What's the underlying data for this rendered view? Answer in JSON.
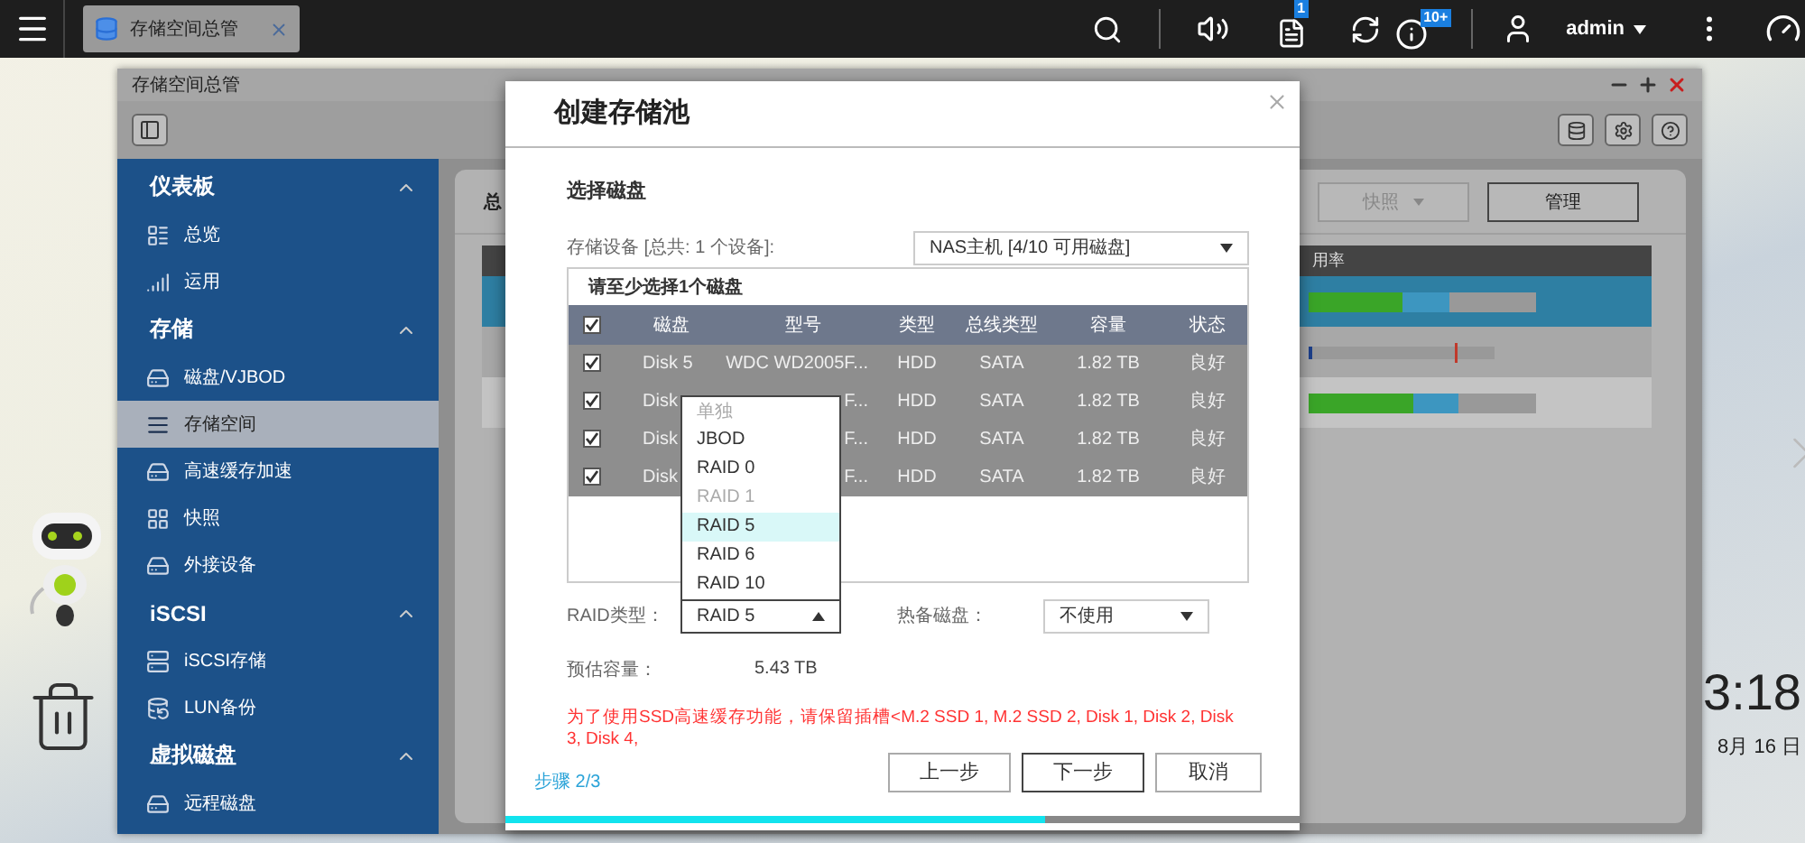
{
  "top_bar": {
    "app_tab": {
      "label": "存储空间总管",
      "selected": true
    },
    "notes_badge": "1",
    "info_badge": "10+",
    "user": "admin"
  },
  "desktop": {
    "time": "3:18",
    "date": "8月 16 日"
  },
  "window": {
    "title": "存储空间总管"
  },
  "sidebar": {
    "sections": [
      {
        "title": "仪表板",
        "expanded": true,
        "items": [
          {
            "label": "总览",
            "selected": false
          },
          {
            "label": "运用",
            "selected": false
          }
        ]
      },
      {
        "title": "存储",
        "expanded": true,
        "items": [
          {
            "label": "磁盘/VJBOD",
            "selected": false
          },
          {
            "label": "存储空间",
            "selected": true
          },
          {
            "label": "高速缓存加速",
            "selected": false
          },
          {
            "label": "快照",
            "selected": false
          },
          {
            "label": "外接设备",
            "selected": false
          }
        ]
      },
      {
        "title": "iSCSI",
        "expanded": true,
        "items": [
          {
            "label": "iSCSI存储",
            "selected": false
          },
          {
            "label": "LUN备份",
            "selected": false
          }
        ]
      },
      {
        "title": "虚拟磁盘",
        "expanded": true,
        "items": [
          {
            "label": "远程磁盘",
            "selected": false
          }
        ]
      }
    ]
  },
  "content": {
    "tab": "总",
    "buttons": [
      {
        "label": "快照",
        "disabled": true
      },
      {
        "label": "管理",
        "disabled": false
      }
    ],
    "table": {
      "column": "用率",
      "rows": [
        {
          "selected": true
        },
        {
          "selected": false
        },
        {
          "selected": false
        }
      ]
    }
  },
  "dialog": {
    "title": "创建存储池",
    "section": "选择磁盘",
    "device_label": "存储设备 [总共: 1 个设备]:",
    "device_select": "NAS主机 [4/10 可用磁盘]",
    "disk_table": {
      "hint": "请至少选择1个磁盘",
      "all_checked": true,
      "columns": [
        "磁盘",
        "型号",
        "类型",
        "总线类型",
        "容量",
        "状态"
      ],
      "rows": [
        {
          "checked": true,
          "cells": [
            "Disk 5",
            "WDC WD2005F...",
            "HDD",
            "SATA",
            "1.82 TB",
            "良好"
          ]
        },
        {
          "checked": true,
          "cells": [
            "Disk",
            "F...",
            "HDD",
            "SATA",
            "1.82 TB",
            "良好"
          ]
        },
        {
          "checked": true,
          "cells": [
            "Disk",
            "F...",
            "HDD",
            "SATA",
            "1.82 TB",
            "良好"
          ]
        },
        {
          "checked": true,
          "cells": [
            "Disk",
            "F...",
            "HDD",
            "SATA",
            "1.82 TB",
            "良好"
          ]
        }
      ]
    },
    "raid_label": "RAID类型：",
    "raid_select": {
      "value": "RAID 5",
      "expanded": true,
      "options": [
        {
          "label": "单独",
          "disabled": true,
          "selected": false
        },
        {
          "label": "JBOD",
          "disabled": false,
          "selected": false
        },
        {
          "label": "RAID 0",
          "disabled": false,
          "selected": false
        },
        {
          "label": "RAID 1",
          "disabled": true,
          "selected": false
        },
        {
          "label": "RAID 5",
          "disabled": false,
          "selected": true
        },
        {
          "label": "RAID 6",
          "disabled": false,
          "selected": false
        },
        {
          "label": "RAID 10",
          "disabled": false,
          "selected": false
        }
      ]
    },
    "spare_label": "热备磁盘：",
    "spare_select": "不使用",
    "capacity_label": "预估容量：",
    "capacity": "5.43 TB",
    "warning": "为了使用SSD高速缓存功能，请保留插槽<M.2 SSD 1, M.2 SSD 2, Disk 1, Disk 2, Disk 3, Disk 4,",
    "step": "步骤 2/3",
    "buttons": [
      {
        "label": "上一步",
        "focused": false
      },
      {
        "label": "下一步",
        "focused": true
      },
      {
        "label": "取消",
        "focused": false
      }
    ],
    "progress": {
      "level": 0.68
    }
  }
}
